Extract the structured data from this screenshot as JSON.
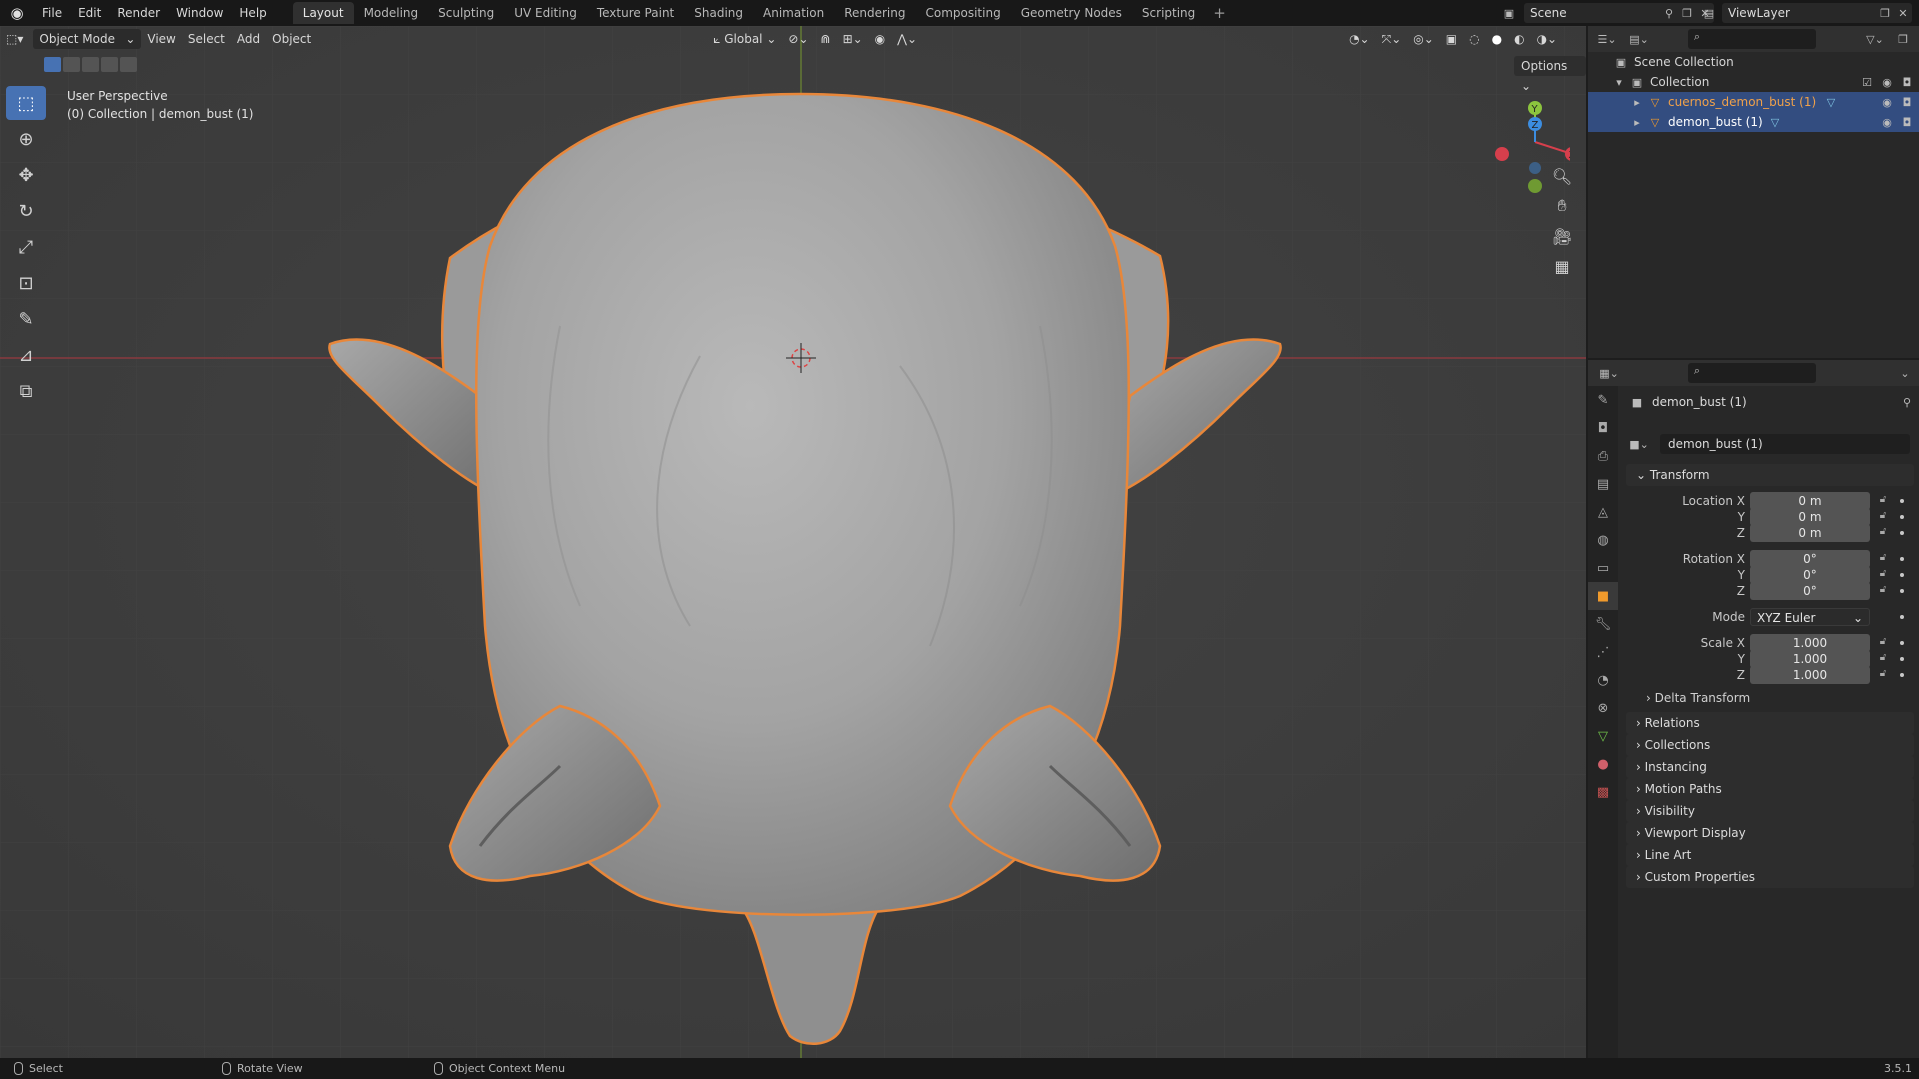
{
  "topbar": {
    "menus": [
      "File",
      "Edit",
      "Render",
      "Window",
      "Help"
    ],
    "workspaces": [
      "Layout",
      "Modeling",
      "Sculpting",
      "UV Editing",
      "Texture Paint",
      "Shading",
      "Animation",
      "Rendering",
      "Compositing",
      "Geometry Nodes",
      "Scripting"
    ],
    "active_workspace": "Layout",
    "scene_name": "Scene",
    "view_layer": "ViewLayer"
  },
  "viewport": {
    "mode": "Object Mode",
    "menus": [
      "View",
      "Select",
      "Add",
      "Object"
    ],
    "orientation": "Global",
    "options_label": "Options",
    "perspective_label": "User Perspective",
    "context_label": "(0) Collection | demon_bust (1)"
  },
  "gizmo": {
    "x_label": "X",
    "y_label": "Y",
    "z_label": "Z"
  },
  "outliner": {
    "scene_collection": "Scene Collection",
    "collection": "Collection",
    "objects": [
      "cuernos_demon_bust (1)",
      "demon_bust (1)"
    ]
  },
  "properties": {
    "object_name": "demon_bust (1)",
    "name_field": "demon_bust (1)",
    "transform_label": "Transform",
    "location_label": "Location X",
    "location": [
      "0 m",
      "0 m",
      "0 m"
    ],
    "rotation_label": "Rotation X",
    "rotation": [
      "0°",
      "0°",
      "0°"
    ],
    "mode_label": "Mode",
    "rotation_mode": "XYZ Euler",
    "scale_label": "Scale X",
    "scale": [
      "1.000",
      "1.000",
      "1.000"
    ],
    "axis_y": "Y",
    "axis_z": "Z",
    "delta_transform": "Delta Transform",
    "panels": [
      "Relations",
      "Collections",
      "Instancing",
      "Motion Paths",
      "Visibility",
      "Viewport Display",
      "Line Art",
      "Custom Properties"
    ]
  },
  "statusbar": {
    "select": "Select",
    "rotate_view": "Rotate View",
    "context_menu": "Object Context Menu",
    "version": "3.5.1"
  },
  "colors": {
    "selection_outline": "#e8873a",
    "active_blue": "#4772b3",
    "axis_red": "#d63f4c",
    "axis_green": "#8cc43e",
    "axis_blue": "#3c8de0"
  }
}
